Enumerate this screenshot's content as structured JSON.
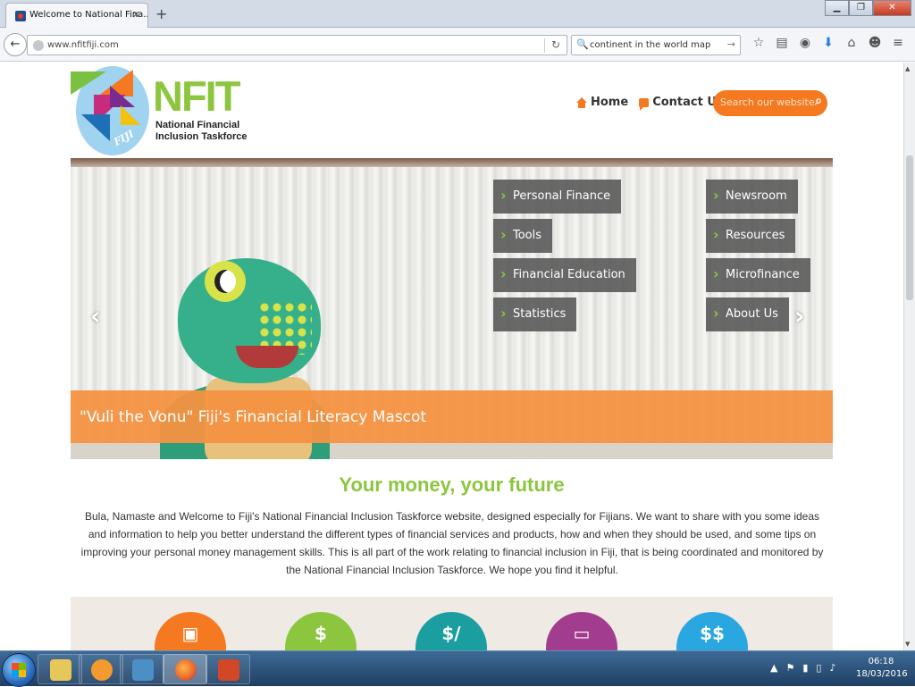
{
  "browser": {
    "tab_title": "Welcome to National Fina...",
    "url": "www.nfitfiji.com",
    "search_query": "continent in the world map",
    "toolbar_icons": [
      "star-icon",
      "reading-list-icon",
      "pocket-icon",
      "download-icon",
      "home-icon",
      "chat-icon",
      "menu-icon"
    ]
  },
  "site": {
    "logo_text": "NFIT",
    "logo_subtitle": "National Financial Inclusion Taskforce",
    "logo_fiji": "FIJI",
    "nav": {
      "home": "Home",
      "contact": "Contact Us"
    },
    "search_placeholder": "Search our website",
    "accent_orange": "#f47920",
    "accent_green": "#8cc63f"
  },
  "hero": {
    "menu_left": [
      "Personal Finance",
      "Tools",
      "Financial Education",
      "Statistics"
    ],
    "menu_right": [
      "Newsroom",
      "Resources",
      "Microfinance",
      "About Us"
    ],
    "caption": "\"Vuli the Vonu\" Fiji's Financial Literacy Mascot"
  },
  "intro": {
    "title": "Your money, your future",
    "text": "Bula, Namaste and Welcome to Fiji's National Financial Inclusion Taskforce website, designed especially for Fijians. We want to share with you some ideas and information to help you better understand the different types of financial services and products, how and when they should be used, and some tips on improving your personal money management skills. This is all part of the work relating to financial inclusion in Fiji, that is being coordinated and monitored by the National Financial Inclusion Taskforce. We hope you find it helpful."
  },
  "features": {
    "circles": [
      {
        "color": "#f47920",
        "icon": "tablet-icon",
        "glyph": "▣"
      },
      {
        "color": "#8cc63f",
        "icon": "money-icon",
        "glyph": "$"
      },
      {
        "color": "#1a9ea0",
        "icon": "calculator-icon",
        "glyph": "$/"
      },
      {
        "color": "#a23c8e",
        "icon": "card-icon",
        "glyph": "▭"
      },
      {
        "color": "#2aa6e0",
        "icon": "coins-icon",
        "glyph": "$$"
      }
    ]
  },
  "taskbar": {
    "apps": [
      {
        "name": "file-explorer-icon",
        "color": "#e8c75a"
      },
      {
        "name": "media-player-icon",
        "color": "#f29a2e"
      },
      {
        "name": "briefcase-icon",
        "color": "#4c8fc7"
      },
      {
        "name": "firefox-icon",
        "color": "#e8642c"
      },
      {
        "name": "powerpoint-icon",
        "color": "#d24726"
      }
    ],
    "time": "06:18",
    "date": "18/03/2016"
  }
}
